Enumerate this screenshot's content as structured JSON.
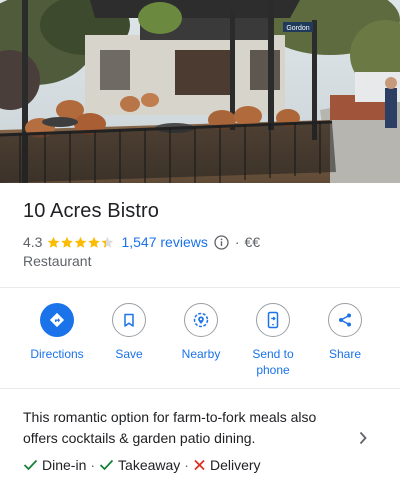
{
  "place": {
    "name": "10 Acres Bistro",
    "rating": "4.3",
    "stars": 4.3,
    "reviews": "1,547 reviews",
    "separator": "·",
    "price": "€€",
    "category": "Restaurant"
  },
  "photo": {
    "street_sign": "Gordon"
  },
  "actions": [
    {
      "label": "Directions",
      "icon": "directions-icon"
    },
    {
      "label": "Save",
      "icon": "bookmark-icon"
    },
    {
      "label": "Nearby",
      "icon": "nearby-icon"
    },
    {
      "label": "Send to phone",
      "icon": "send-to-phone-icon"
    },
    {
      "label": "Share",
      "icon": "share-icon"
    }
  ],
  "about": {
    "description": "This romantic option for farm-to-fork meals also offers cocktails & garden patio dining.",
    "services": [
      {
        "label": "Dine-in",
        "available": true
      },
      {
        "label": "Takeaway",
        "available": true
      },
      {
        "label": "Delivery",
        "available": false
      }
    ],
    "dot": "·"
  },
  "colors": {
    "accent": "#1a73e8",
    "star": "#fbbc04",
    "check": "#188038",
    "cross": "#d93025"
  }
}
